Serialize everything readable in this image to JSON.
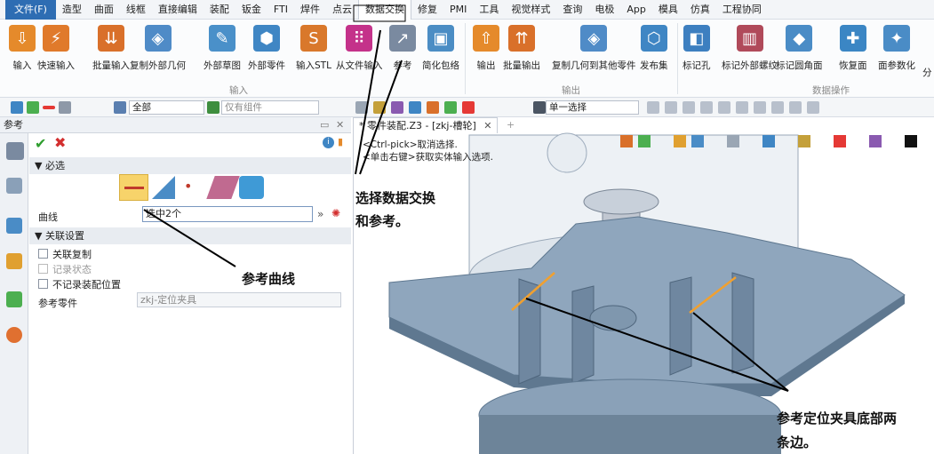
{
  "menu": [
    "文件(F)",
    "造型",
    "曲面",
    "线框",
    "直接编辑",
    "装配",
    "钣金",
    "FTI",
    "焊件",
    "点云",
    "数据交换",
    "修复",
    "PMI",
    "工具",
    "视觉样式",
    "查询",
    "电极",
    "App",
    "模具",
    "仿真",
    "工程协同"
  ],
  "ribbon": {
    "input_group": [
      "输入",
      "快速输入",
      "批量输入",
      "复制外部几何",
      "外部草图",
      "外部零件",
      "输入STL",
      "从文件输入",
      "参考",
      "简化包络"
    ],
    "output_group": [
      "输出",
      "批量输出",
      "复制几何到其他零件",
      "发布集"
    ],
    "ops_group": [
      "标记孔",
      "标记外部螺纹",
      "标记圆角面",
      "恢复面",
      "面参数化",
      "分"
    ],
    "group_labels": {
      "input": "输入",
      "output": "输出",
      "ops": "数据操作"
    }
  },
  "toolbar": {
    "filter_value": "全部",
    "component_value": "仅有组件",
    "select_mode": "单一选择"
  },
  "panel": {
    "title": "参考",
    "required_section": "▼ 必选",
    "curve_label": "曲线",
    "curve_value": "选中2个",
    "assoc_section": "▼ 关联设置",
    "opt_assoc_copy": "关联复制",
    "opt_record_state": "记录状态",
    "opt_no_record_pos": "不记录装配位置",
    "ref_part_label": "参考零件",
    "ref_part_value": "zkj-定位夹具"
  },
  "viewport": {
    "tab_label": "* 零件装配.Z3 - [zkj-槽轮]",
    "hint1": "<Ctrl-pick>取消选择.",
    "hint2": "<单击右键>获取实体输入选项."
  },
  "callouts": {
    "c1_line1": "选择数据交换",
    "c1_line2": "和参考。",
    "c2": "参考曲线",
    "c3_line1": "参考定位夹具底部两",
    "c3_line2": "条边。"
  },
  "colors": {
    "accent": "#2e6db3",
    "part_fill": "#8fa6bd",
    "part_dark": "#5f7890",
    "edge_highlight": "#f0a030"
  }
}
